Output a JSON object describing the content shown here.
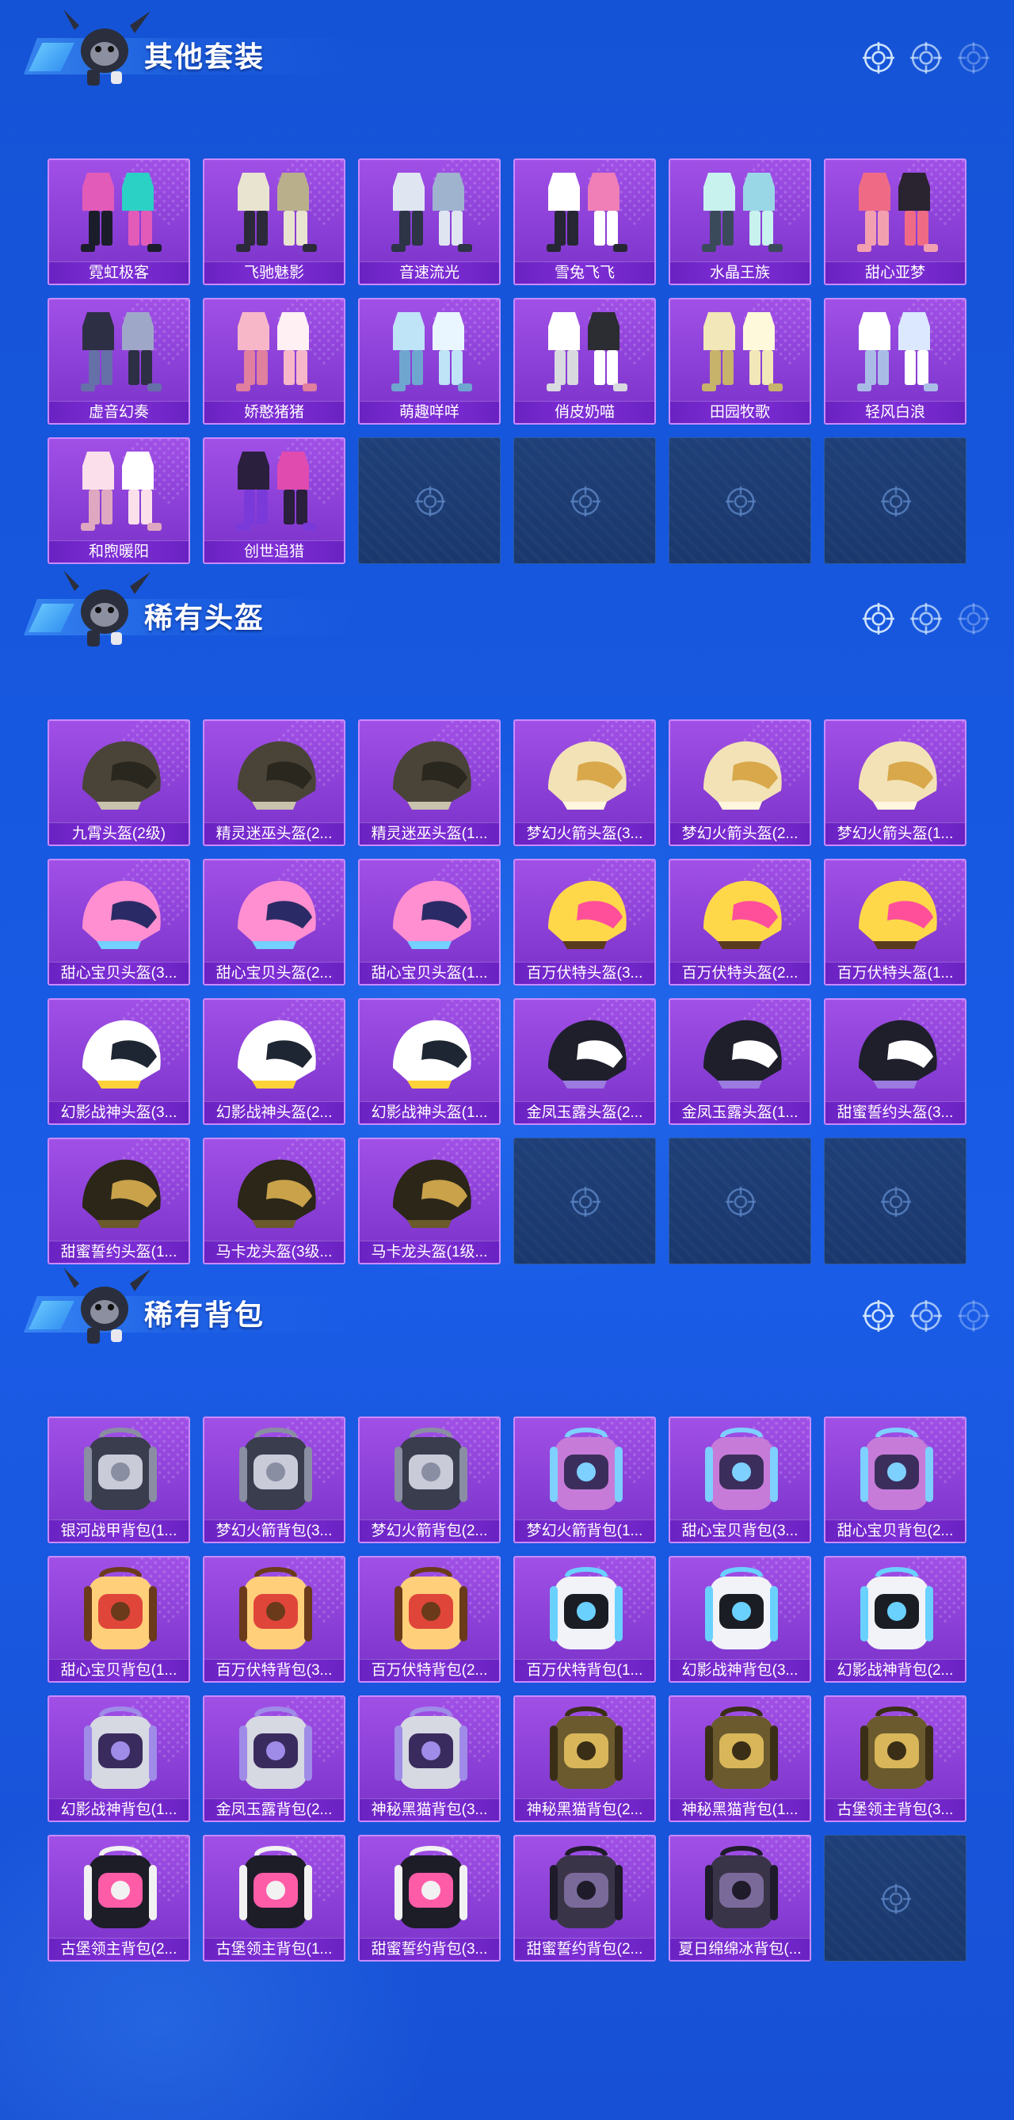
{
  "sections": [
    {
      "title": "其他套装",
      "kind": "suit",
      "items": [
        "霓虹极客",
        "飞驰魅影",
        "音速流光",
        "雪兔飞飞",
        "水晶王族",
        "甜心亚梦",
        "虚音幻奏",
        "娇憨猪猪",
        "萌趣咩咩",
        "俏皮奶喵",
        "田园牧歌",
        "轻风白浪",
        "和煦暖阳",
        "创世追猎"
      ],
      "empty_slots": 4
    },
    {
      "title": "稀有头盔",
      "kind": "helmet",
      "items": [
        "九霄头盔(2级)",
        "精灵迷巫头盔(2...",
        "精灵迷巫头盔(1...",
        "梦幻火箭头盔(3...",
        "梦幻火箭头盔(2...",
        "梦幻火箭头盔(1...",
        "甜心宝贝头盔(3...",
        "甜心宝贝头盔(2...",
        "甜心宝贝头盔(1...",
        "百万伏特头盔(3...",
        "百万伏特头盔(2...",
        "百万伏特头盔(1...",
        "幻影战神头盔(3...",
        "幻影战神头盔(2...",
        "幻影战神头盔(1...",
        "金凤玉露头盔(2...",
        "金凤玉露头盔(1...",
        "甜蜜誓约头盔(3...",
        "甜蜜誓约头盔(1...",
        "马卡龙头盔(3级...",
        "马卡龙头盔(1级..."
      ],
      "empty_slots": 3
    },
    {
      "title": "稀有背包",
      "kind": "backpack",
      "items": [
        "银河战甲背包(1...",
        "梦幻火箭背包(3...",
        "梦幻火箭背包(2...",
        "梦幻火箭背包(1...",
        "甜心宝贝背包(3...",
        "甜心宝贝背包(2...",
        "甜心宝贝背包(1...",
        "百万伏特背包(3...",
        "百万伏特背包(2...",
        "百万伏特背包(1...",
        "幻影战神背包(3...",
        "幻影战神背包(2...",
        "幻影战神背包(1...",
        "金凤玉露背包(2...",
        "神秘黑猫背包(3...",
        "神秘黑猫背包(2...",
        "神秘黑猫背包(1...",
        "古堡领主背包(3...",
        "古堡领主背包(2...",
        "古堡领主背包(1...",
        "甜蜜誓约背包(3...",
        "甜蜜誓约背包(2...",
        "夏日绵绵冰背包(..."
      ],
      "empty_slots": 1
    }
  ],
  "colors": {
    "background": "#1758e0",
    "card": "#8a3fd6",
    "card_border": "#c98bff",
    "label_bar": "#6a22c2",
    "empty_slot": "#1d3b72",
    "reticle": "#cfe4ff"
  },
  "icons": {
    "header_mascot": "monkey-mascot-icon",
    "header_reticle": "crosshair-reticle-icon",
    "empty_slot": "crosshair-reticle-icon"
  }
}
